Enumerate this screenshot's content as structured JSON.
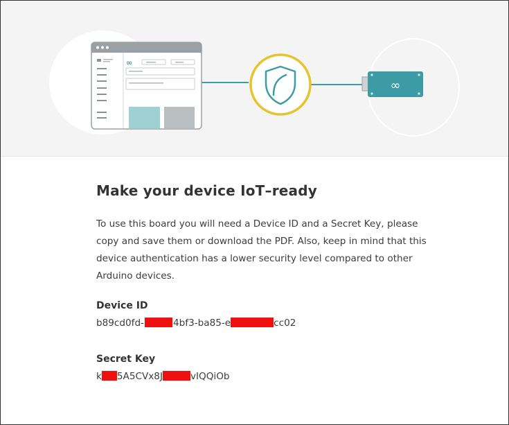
{
  "dialog": {
    "title": "Make your device IoT–ready",
    "description": "To use this board you will need a Device ID and a Secret Key, please copy and save them or download the PDF. Also, keep in mind that this device authentication has a lower security level compared to other Arduino devices."
  },
  "device_id": {
    "label": "Device ID",
    "value_part1": "b89cd0fd-",
    "value_part2": "4bf3-ba85-e",
    "value_part3": "cc02"
  },
  "secret_key": {
    "label": "Secret Key",
    "value_part1": "k",
    "value_part2": "5A5CVx8J",
    "value_part3": "vIQQiOb"
  },
  "illustration": {
    "board_logo": "∞",
    "icons": [
      "browser-window-icon",
      "shield-icon",
      "arduino-board-icon"
    ],
    "colors": {
      "teal": "#3d9ba6",
      "shield_ring": "#e6c430",
      "redaction": "#ef1010"
    }
  }
}
